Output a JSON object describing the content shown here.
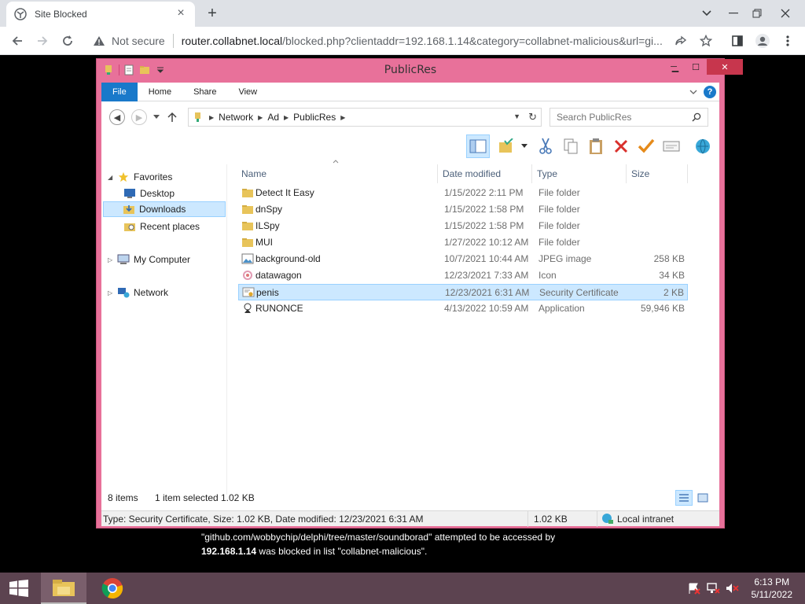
{
  "browser": {
    "tab_title": "Site Blocked",
    "not_secure": "Not secure",
    "url_host": "router.collabnet.local",
    "url_rest": "/blocked.php?clientaddr=192.168.1.14&category=collabnet-malicious&url=gi..."
  },
  "explorer": {
    "window_title": "PublicRes",
    "ribbon_tabs": [
      "File",
      "Home",
      "Share",
      "View"
    ],
    "breadcrumb": [
      "Network",
      "Ad",
      "PublicRes"
    ],
    "search_placeholder": "Search PublicRes",
    "nav": {
      "favorites": "Favorites",
      "desktop": "Desktop",
      "downloads": "Downloads",
      "recent": "Recent places",
      "computer": "My Computer",
      "network": "Network"
    },
    "columns": {
      "name": "Name",
      "date": "Date modified",
      "type": "Type",
      "size": "Size"
    },
    "files": [
      {
        "name": "Detect It Easy",
        "date": "1/15/2022 2:11 PM",
        "type": "File folder",
        "size": "",
        "icon": "folder-icon"
      },
      {
        "name": "dnSpy",
        "date": "1/15/2022 1:58 PM",
        "type": "File folder",
        "size": "",
        "icon": "folder-icon"
      },
      {
        "name": "ILSpy",
        "date": "1/15/2022 1:58 PM",
        "type": "File folder",
        "size": "",
        "icon": "folder-icon"
      },
      {
        "name": "MUI",
        "date": "1/27/2022 10:12 AM",
        "type": "File folder",
        "size": "",
        "icon": "folder-icon"
      },
      {
        "name": "background-old",
        "date": "10/7/2021 10:44 AM",
        "type": "JPEG image",
        "size": "258 KB",
        "icon": "image-icon"
      },
      {
        "name": "datawagon",
        "date": "12/23/2021 7:33 AM",
        "type": "Icon",
        "size": "34 KB",
        "icon": "icon-file-icon"
      },
      {
        "name": "penis",
        "date": "12/23/2021 6:31 AM",
        "type": "Security Certificate",
        "size": "2 KB",
        "icon": "certificate-icon"
      },
      {
        "name": "RUNONCE",
        "date": "4/13/2022 10:59 AM",
        "type": "Application",
        "size": "59,946 KB",
        "icon": "application-icon"
      }
    ],
    "status": {
      "items": "8 items",
      "selected": "1 item selected",
      "selected_size": "1.02 KB"
    },
    "infobar": {
      "details": "Type: Security Certificate, Size: 1.02 KB, Date modified: 12/23/2021 6:31 AM",
      "size": "1.02 KB",
      "zone": "Local intranet"
    }
  },
  "block_message": {
    "line1": "\"github.com/wobbychip/delphi/tree/master/soundborad\" attempted to be accessed by",
    "ip": "192.168.1.14",
    "line2": " was blocked in list \"collabnet-malicious\"."
  },
  "taskbar": {
    "time": "6:13 PM",
    "date": "5/11/2022"
  }
}
